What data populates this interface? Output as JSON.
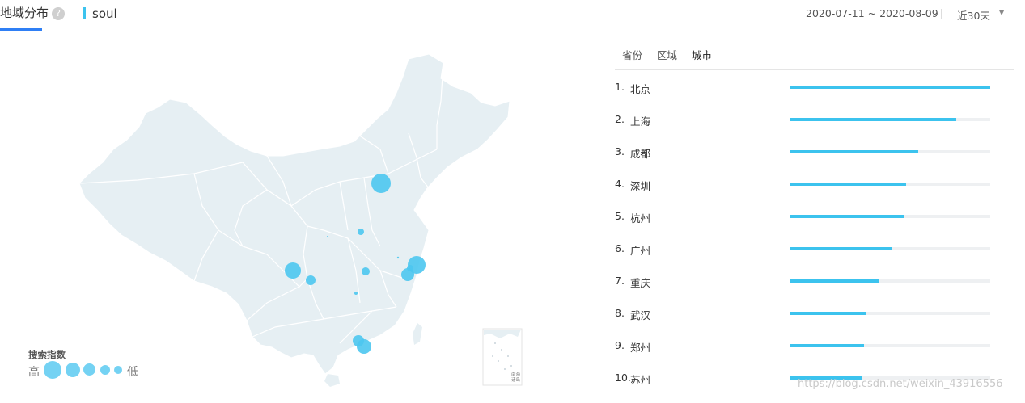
{
  "header": {
    "tab_label": "地域分布",
    "help_icon": "?",
    "keyword": "soul",
    "date_range": "2020-07-11 ~ 2020-08-09",
    "period": "近30天",
    "period_arrow": "▼"
  },
  "map": {
    "inset_label_1": "南海",
    "inset_label_2": "诸岛",
    "legend_title": "搜索指数",
    "legend_high": "高",
    "legend_low": "低",
    "colors": {
      "land": "#e6eff3",
      "bubble": "#4cc6f0",
      "border": "#ffffff"
    }
  },
  "panel": {
    "tabs": [
      {
        "label": "省份"
      },
      {
        "label": "区域"
      },
      {
        "label": "城市",
        "active": true
      }
    ],
    "ranking": [
      {
        "rank": "1.",
        "name": "北京",
        "value": 1.0
      },
      {
        "rank": "2.",
        "name": "上海",
        "value": 0.83
      },
      {
        "rank": "3.",
        "name": "成都",
        "value": 0.64
      },
      {
        "rank": "4.",
        "name": "深圳",
        "value": 0.58
      },
      {
        "rank": "5.",
        "name": "杭州",
        "value": 0.57
      },
      {
        "rank": "6.",
        "name": "广州",
        "value": 0.51
      },
      {
        "rank": "7.",
        "name": "重庆",
        "value": 0.44
      },
      {
        "rank": "8.",
        "name": "武汉",
        "value": 0.38
      },
      {
        "rank": "9.",
        "name": "郑州",
        "value": 0.37
      },
      {
        "rank": "10.",
        "name": "苏州",
        "value": 0.36
      }
    ],
    "bar_color": "#3cc3ee"
  },
  "watermark": "https://blog.csdn.net/weixin_43916556"
}
